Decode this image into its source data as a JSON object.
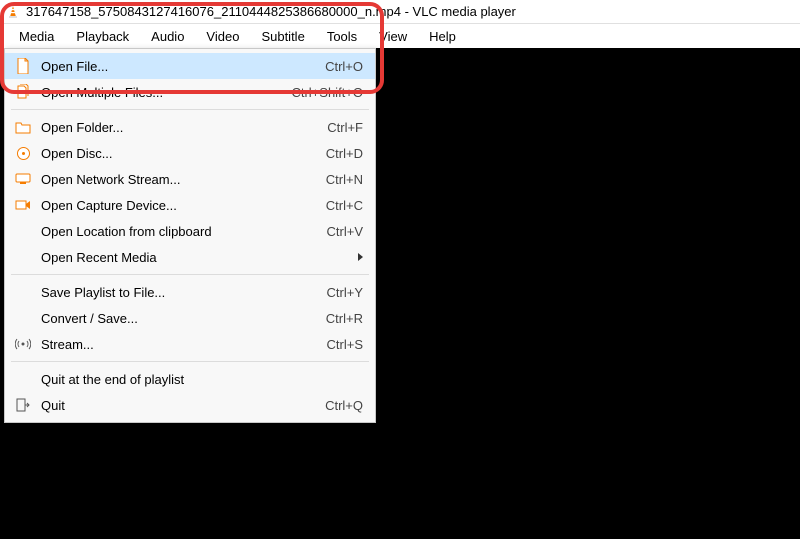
{
  "title": "317647158_5750843127416076_2110444825386680000_n.mp4 - VLC media player",
  "menubar": {
    "media": "Media",
    "playback": "Playback",
    "audio": "Audio",
    "video": "Video",
    "subtitle": "Subtitle",
    "tools": "Tools",
    "view": "View",
    "help": "Help"
  },
  "dropdown": {
    "open_file": {
      "label": "Open File...",
      "shortcut": "Ctrl+O"
    },
    "open_multiple": {
      "label": "Open Multiple Files...",
      "shortcut": "Ctrl+Shift+O"
    },
    "open_folder": {
      "label": "Open Folder...",
      "shortcut": "Ctrl+F"
    },
    "open_disc": {
      "label": "Open Disc...",
      "shortcut": "Ctrl+D"
    },
    "open_network": {
      "label": "Open Network Stream...",
      "shortcut": "Ctrl+N"
    },
    "open_capture": {
      "label": "Open Capture Device...",
      "shortcut": "Ctrl+C"
    },
    "open_clipboard": {
      "label": "Open Location from clipboard",
      "shortcut": "Ctrl+V"
    },
    "open_recent": {
      "label": "Open Recent Media"
    },
    "save_playlist": {
      "label": "Save Playlist to File...",
      "shortcut": "Ctrl+Y"
    },
    "convert_save": {
      "label": "Convert / Save...",
      "shortcut": "Ctrl+R"
    },
    "stream": {
      "label": "Stream...",
      "shortcut": "Ctrl+S"
    },
    "quit_end": {
      "label": "Quit at the end of playlist"
    },
    "quit": {
      "label": "Quit",
      "shortcut": "Ctrl+Q"
    }
  }
}
